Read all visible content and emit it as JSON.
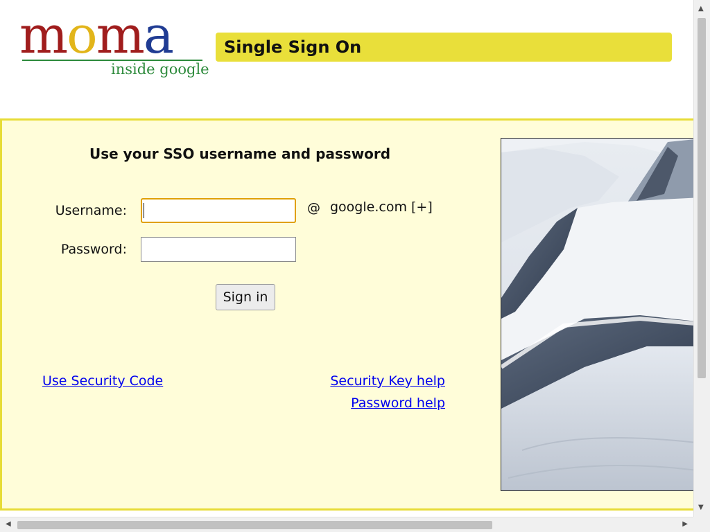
{
  "header": {
    "logo_letters": [
      "m",
      "o",
      "m",
      "a"
    ],
    "logo_subtitle": "inside google",
    "title": "Single Sign On"
  },
  "form": {
    "heading": "Use your SSO username and password",
    "username_label": "Username:",
    "username_value": "",
    "at_sign": "@",
    "domain": "google.com [+]",
    "password_label": "Password:",
    "password_value": "",
    "submit_label": "Sign in"
  },
  "links": {
    "security_code": "Use Security Code",
    "security_key_help": "Security Key help",
    "password_help": "Password help"
  },
  "colors": {
    "title_bar": "#e9df3a",
    "panel_background": "#fffdd9",
    "panel_border": "#e7dc37",
    "link": "#0000ee",
    "logo_red": "#a01d1d",
    "logo_yellow": "#e2b51a",
    "logo_blue": "#203c93",
    "logo_green": "#2c8a3b"
  },
  "icons": {
    "scroll_up": "triangle-up-icon",
    "scroll_down": "triangle-down-icon",
    "scroll_left": "triangle-left-icon",
    "scroll_right": "triangle-right-icon"
  }
}
